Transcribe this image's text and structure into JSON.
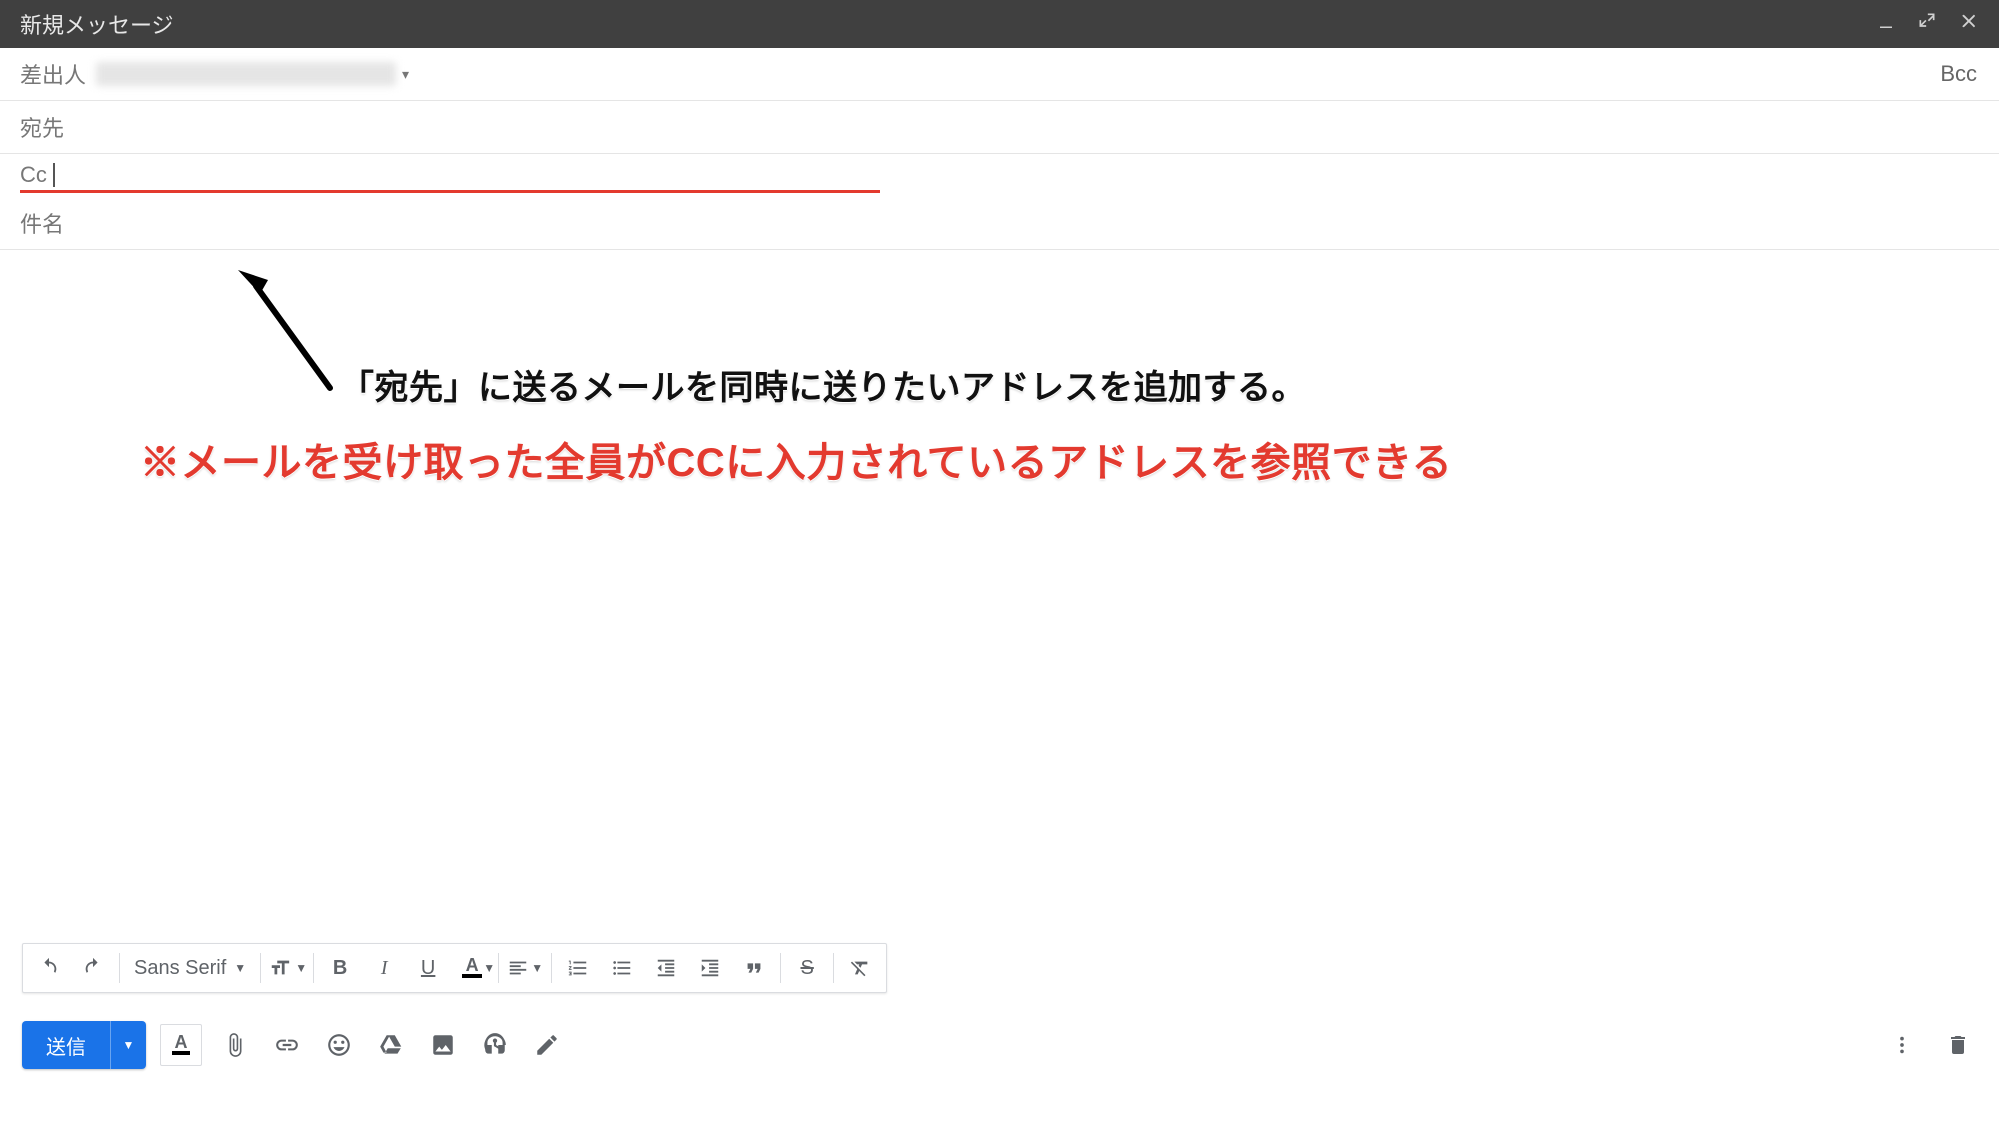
{
  "titlebar": {
    "title": "新規メッセージ"
  },
  "fields": {
    "from_label": "差出人",
    "to_label": "宛先",
    "cc_label": "Cc",
    "bcc_label": "Bcc",
    "subject_label": "件名"
  },
  "annotations": {
    "line1": "「宛先」に送るメールを同時に送りたいアドレスを追加する。",
    "line2": "※メールを受け取った全員がCCに入力されているアドレスを参照できる"
  },
  "format_toolbar": {
    "font_name": "Sans Serif",
    "bold": "B",
    "italic": "I",
    "underline": "U",
    "text_color": "A",
    "quote": "❝❞",
    "strike": "S"
  },
  "action_bar": {
    "send_label": "送信",
    "text_color": "A"
  }
}
